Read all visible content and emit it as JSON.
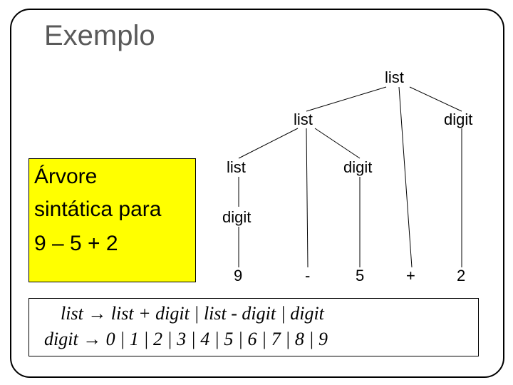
{
  "title": "Exemplo",
  "tree": {
    "n1": "list",
    "n2": "list",
    "n3": "digit",
    "n4": "list",
    "n5": "digit",
    "n6": "digit",
    "t1": "9",
    "t2": "-",
    "t3": "5",
    "t4": "+",
    "t5": "2"
  },
  "caption": {
    "line1": "Árvore",
    "line2": "sintática para",
    "line3": "9 – 5 + 2"
  },
  "grammar": {
    "rule1_lhs": "list",
    "rule1_rhs": "list + digit | list - digit | digit",
    "rule2_lhs": "digit",
    "rule2_rhs": "0 | 1 | 2 | 3 | 4 | 5 | 6 | 7 | 8 | 9",
    "arrow": "→"
  }
}
